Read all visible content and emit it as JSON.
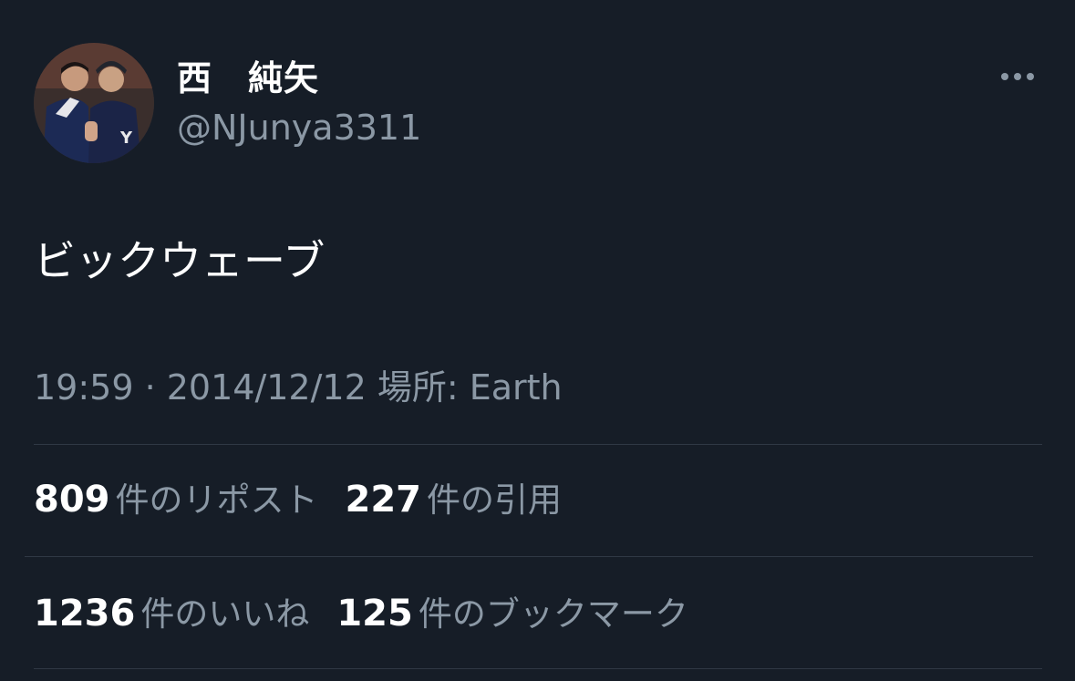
{
  "author": {
    "display_name": "西　純矢",
    "handle": "@NJunya3311",
    "avatar_icon": "profile-photo"
  },
  "more_icon": "more-horizontal-icon",
  "tweet": {
    "text": "ビックウェーブ"
  },
  "meta": {
    "text": "19:59 · 2014/12/12 場所: Earth"
  },
  "stats": {
    "reposts": {
      "count": "809",
      "label": "件のリポスト"
    },
    "quotes": {
      "count": "227",
      "label": "件の引用"
    },
    "likes": {
      "count": "1236",
      "label": "件のいいね"
    },
    "bookmarks": {
      "count": "125",
      "label": "件のブックマーク"
    }
  },
  "colors": {
    "background": "#161d27",
    "primary_text": "#ffffff",
    "secondary_text": "#8b98a5",
    "divider": "#2f3844"
  }
}
